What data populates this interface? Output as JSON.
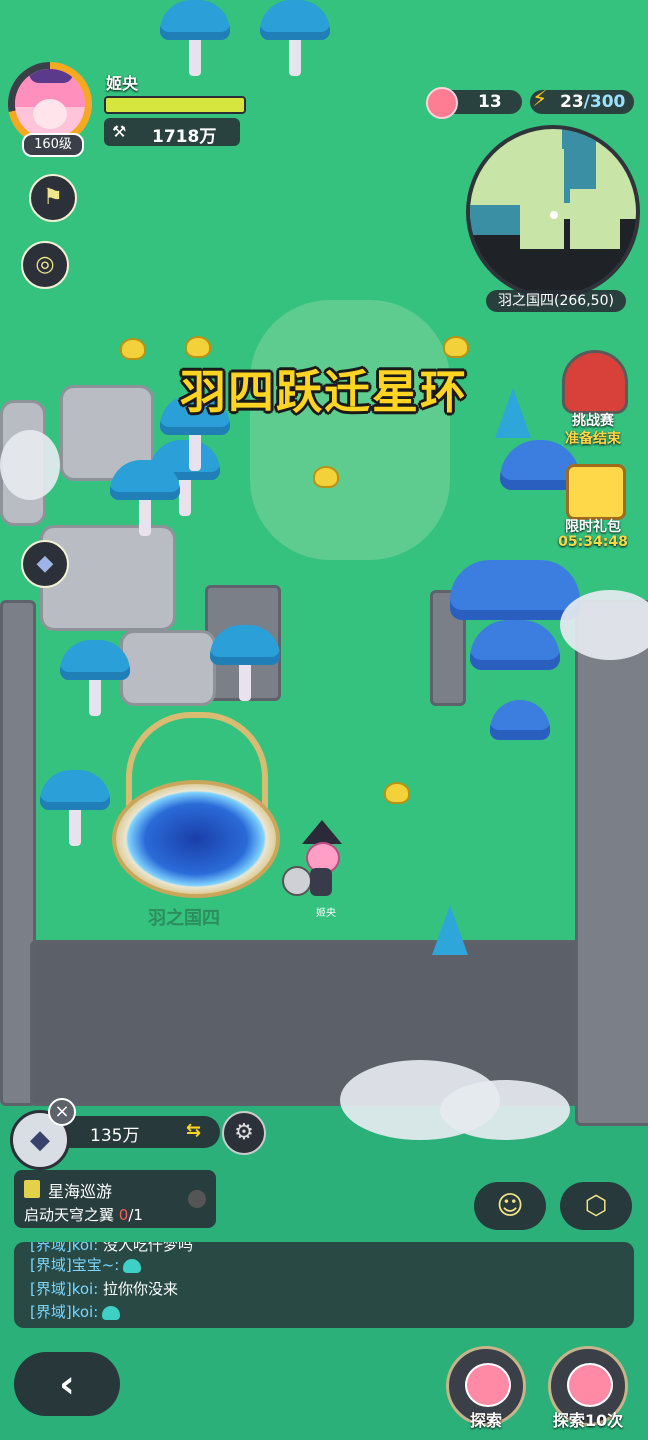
{
  "player": {
    "name": "姬央",
    "level": "160级",
    "level_progress": 0.72,
    "hp_fraction": 1.0,
    "power_icon": "crossed-tools-icon",
    "power": "1718万"
  },
  "resources": {
    "peach_icon": "peach-icon",
    "peach_count": "13",
    "energy_icon": "lightning-icon",
    "energy_current": "23",
    "energy_sep": "/",
    "energy_max": "300"
  },
  "minimap": {
    "coords": "羽之国四(266,50)"
  },
  "zone": {
    "title": "羽四跃迁星环",
    "portal_label": "羽之国四",
    "hero_label": "姬央"
  },
  "left_buttons": [
    {
      "name": "flag-icon"
    },
    {
      "name": "target-icon"
    },
    {
      "name": "crystal-icon"
    }
  ],
  "events": {
    "challenge_title": "挑战赛",
    "challenge_status": "准备结束",
    "gift_title": "限时礼包",
    "gift_timer": "05:34:48"
  },
  "bottom": {
    "crystal_value": "135万",
    "quest_title": "星海巡游",
    "quest_desc": "启动天穹之翼 ",
    "quest_current": "0",
    "quest_total": "/1",
    "chat": [
      {
        "channel": "[界域]",
        "who": "koi:",
        "msg": " 没人吃仟梦吗"
      },
      {
        "channel": "[界域]",
        "who": "宝宝~:",
        "msg": ""
      },
      {
        "channel": "[界域]",
        "who": "koi:",
        "msg": " 拉你你没来"
      },
      {
        "channel": "[界域]",
        "who": "koi:",
        "msg": ""
      }
    ],
    "explore_label": "探索",
    "explore10_label": "探索10次"
  },
  "colors": {
    "accent": "#ffd422",
    "grass": "#34c27e",
    "panel": "#282c34"
  }
}
